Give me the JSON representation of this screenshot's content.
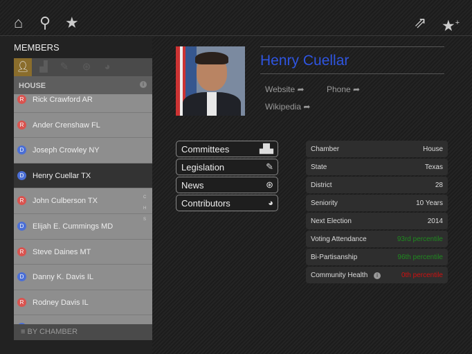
{
  "topbar": {
    "icons": [
      "home-icon",
      "search-icon",
      "star-icon",
      "share-icon",
      "star-add-icon"
    ]
  },
  "sidebar": {
    "title": "MEMBERS",
    "tabs": [
      "person-icon",
      "committees-icon",
      "legislation-icon",
      "news-icon",
      "contributors-icon"
    ],
    "section": "HOUSE",
    "members": [
      {
        "name": "Rick Crawford AR",
        "party": "R"
      },
      {
        "name": "Ander Crenshaw FL",
        "party": "R"
      },
      {
        "name": "Joseph Crowley NY",
        "party": "D"
      },
      {
        "name": "Henry Cuellar TX",
        "party": "D",
        "selected": true
      },
      {
        "name": "John Culberson TX",
        "party": "R"
      },
      {
        "name": "Elijah E. Cummings MD",
        "party": "D"
      },
      {
        "name": "Steve Daines MT",
        "party": "R"
      },
      {
        "name": "Danny K. Davis IL",
        "party": "D"
      },
      {
        "name": "Rodney Davis IL",
        "party": "R"
      },
      {
        "name": "",
        "party": "D"
      }
    ],
    "index": [
      "C",
      "H",
      "S"
    ],
    "footer": "BY CHAMBER"
  },
  "colors": {
    "republican": "#d9534f",
    "democrat": "#4b6fd6",
    "accent": "#8a6d2c",
    "good": "#1f8a1f",
    "bad": "#d01010",
    "name": "#2f55e0"
  },
  "profile": {
    "name": "Henry Cuellar",
    "website": "Website",
    "phone": "Phone",
    "wikipedia": "Wikipedia"
  },
  "buttons": [
    {
      "label": "Committees",
      "icon": "committees-icon"
    },
    {
      "label": "Legislation",
      "icon": "legislation-icon"
    },
    {
      "label": "News",
      "icon": "news-icon"
    },
    {
      "label": "Contributors",
      "icon": "pie-icon"
    }
  ],
  "details": [
    {
      "label": "Chamber",
      "value": "House"
    },
    {
      "label": "State",
      "value": "Texas"
    },
    {
      "label": "District",
      "value": "28"
    },
    {
      "label": "Seniority",
      "value": "10 Years"
    },
    {
      "label": "Next Election",
      "value": "2014"
    },
    {
      "label": "Voting Attendance",
      "value": "93rd percentile",
      "status": "good"
    },
    {
      "label": "Bi-Partisanship",
      "value": "96th percentile",
      "status": "good"
    },
    {
      "label": "Community Health",
      "value": "0th percentile",
      "status": "bad",
      "info": true
    }
  ]
}
